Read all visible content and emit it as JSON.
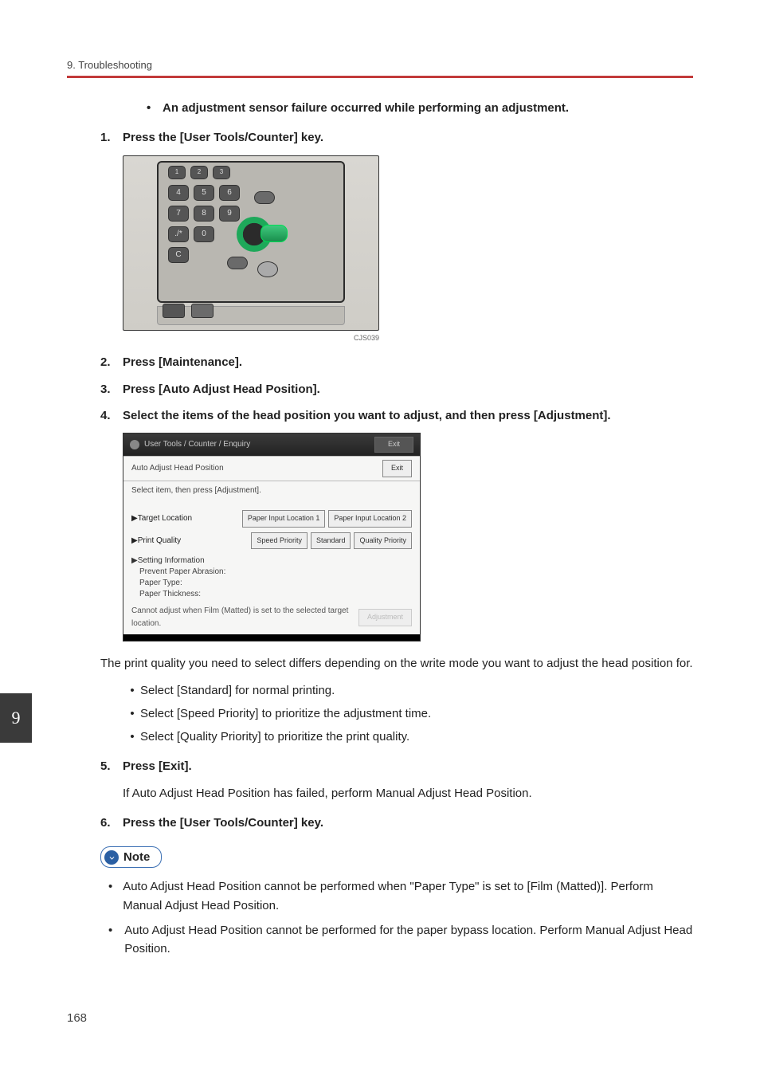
{
  "header": {
    "breadcrumb": "9. Troubleshooting"
  },
  "bullet_intro": "An adjustment sensor failure occurred while performing an adjustment.",
  "steps": {
    "s1": {
      "num": "1.",
      "text": "Press the [User Tools/Counter] key."
    },
    "s2": {
      "num": "2.",
      "text": "Press [Maintenance]."
    },
    "s3": {
      "num": "3.",
      "text": "Press [Auto Adjust Head Position]."
    },
    "s4": {
      "num": "4.",
      "text": "Select the items of the head position you want to adjust, and then press [Adjustment]."
    },
    "s5": {
      "num": "5.",
      "text": "Press [Exit]."
    },
    "s6": {
      "num": "6.",
      "text": "Press the [User Tools/Counter] key."
    }
  },
  "illus1_caption": "CJS039",
  "dlg": {
    "title": "User Tools / Counter / Enquiry",
    "exit_top": "Exit",
    "row1_lab": "Auto Adjust Head Position",
    "row1_btn": "Exit",
    "row2_lab": "Select item, then press [Adjustment].",
    "target_lab": "▶Target Location",
    "target_b1": "Paper Input Location 1",
    "target_b2": "Paper Input Location 2",
    "pq_lab": "▶Print Quality",
    "pq_b1": "Speed Priority",
    "pq_b2": "Standard",
    "pq_b3": "Quality Priority",
    "settings_hd": "▶Setting Information",
    "settings_l1": "Prevent Paper Abrasion:",
    "settings_l2": "Paper Type:",
    "settings_l3": "Paper Thickness:",
    "foot_msg": "Cannot adjust when Film (Matted) is set to the selected target location.",
    "foot_btn": "Adjustment"
  },
  "para_pq": "The print quality you need to select differs depending on the write mode you want to adjust the head position for.",
  "pq_bullets": {
    "b1": "Select [Standard] for normal printing.",
    "b2": "Select [Speed Priority] to prioritize the adjustment time.",
    "b3": "Select [Quality Priority] to prioritize the print quality."
  },
  "after5": "If Auto Adjust Head Position has failed, perform Manual Adjust Head Position.",
  "note_label": "Note",
  "note": {
    "n1": "Auto Adjust Head Position cannot be performed when \"Paper Type\" is set to [Film (Matted)]. Perform Manual Adjust Head Position.",
    "n2": "Auto Adjust Head Position cannot be performed for the paper bypass location. Perform Manual Adjust Head Position."
  },
  "side_tab": "9",
  "page_number": "168"
}
